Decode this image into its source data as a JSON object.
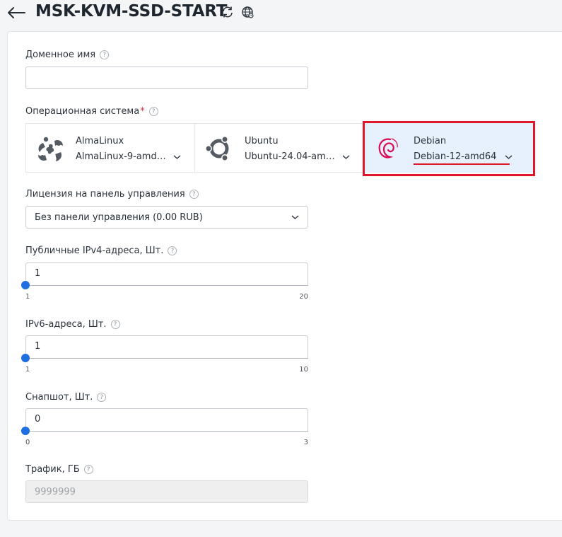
{
  "header": {
    "title": "MSK-KVM-SSD-START",
    "icons": [
      "arrow-left-icon",
      "refresh-icon",
      "globe-icon"
    ]
  },
  "form": {
    "domain": {
      "label": "Доменное имя",
      "value": ""
    },
    "os": {
      "label": "Операционная система",
      "required_mark": "*",
      "options": [
        {
          "name": "AlmaLinux",
          "version": "AlmaLinux-9-amd…",
          "icon": "almalinux-logo-icon",
          "selected": false
        },
        {
          "name": "Ubuntu",
          "version": "Ubuntu-24.04-am…",
          "icon": "ubuntu-logo-icon",
          "selected": false
        },
        {
          "name": "Debian",
          "version": "Debian-12-amd64",
          "icon": "debian-logo-icon",
          "selected": true
        }
      ]
    },
    "license": {
      "label": "Лицензия на панель управления",
      "value": "Без панели управления (0.00 RUB)"
    },
    "ipv4": {
      "label": "Публичные IPv4-адреса, Шт.",
      "value": "1",
      "min": "1",
      "max": "20",
      "level": 0
    },
    "ipv6": {
      "label": "IPv6-адреса, Шт.",
      "value": "1",
      "min": "1",
      "max": "10",
      "level": 0
    },
    "snapshot": {
      "label": "Снапшот, Шт.",
      "value": "0",
      "min": "0",
      "max": "3",
      "level": 0
    },
    "traffic": {
      "label": "Трафик, ГБ",
      "value": "9999999"
    },
    "help_glyph": "?"
  },
  "colors": {
    "accent": "#1f6fe0",
    "selected_bg": "#e6f1fd",
    "highlight": "#e0162b",
    "required": "#e0263d",
    "debian": "#d70a53"
  }
}
